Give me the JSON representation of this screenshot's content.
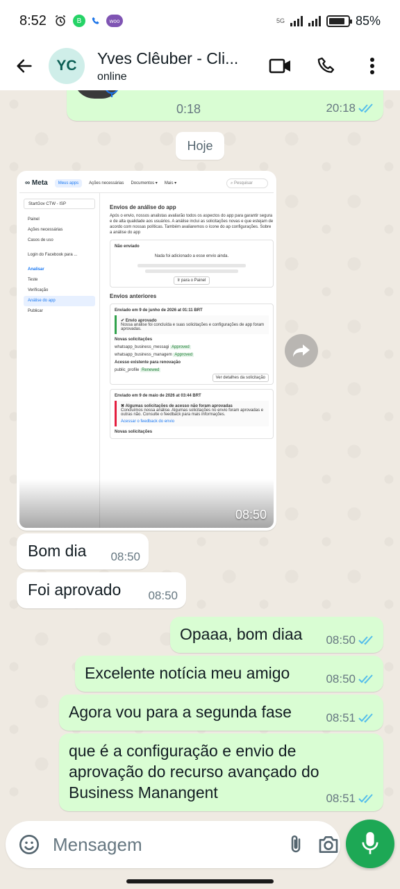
{
  "status_bar": {
    "time": "8:52",
    "network": "5G",
    "battery_pct": "85%",
    "battery_level": 0.85,
    "notification_badge": "woo"
  },
  "header": {
    "avatar_initials": "YC",
    "contact_name": "Yves Clêuber - Cli...",
    "status": "online"
  },
  "messages": {
    "audio": {
      "duration": "0:18",
      "time": "20:18"
    },
    "date_divider": "Hoje",
    "image": {
      "time": "08:50",
      "content": {
        "brand": "Meta",
        "nav": [
          "Meus apps",
          "Ações necessárias",
          "Documentos ▾",
          "Mais ▾"
        ],
        "search": "Pesquisar",
        "app_selector": "StartGov CTW - ISP",
        "sidebar": [
          "Painel",
          "Ações necessárias",
          "Casos de uso",
          "Login do Facebook para ...",
          "Analisar",
          "Teste",
          "Verificação",
          "Análise do app",
          "Publicar"
        ],
        "title": "Envios de análise do app",
        "intro": "Após o envio, nossos analistas avaliarão todos os aspectos do app para garantir segura e de alta qualidade aos usuários. A análise inclui as solicitações novas e que estejam de acordo com nossas políticas. Também avaliaremos o ícone do ap configurações. Sobre a análise do app",
        "not_sent": "Não enviado",
        "not_sent_text": "Nada foi adicionado a esse envio ainda.",
        "go_panel": "Ir para o Painel",
        "previous": "Envios anteriores",
        "sent1": "Enviado em 9 de junho de 2026 at 01:11 BRT",
        "approved": "Envio aprovado",
        "approved_text": "Nossa análise foi concluída e suas solicitações e configurações de app foram aprovadas.",
        "new_requests": "Novas solicitações",
        "req1": "whatsapp_business_messagi",
        "req2": "whatsapp_business_managem",
        "badge_approved": "Approved",
        "existing": "Acesso existente para renovação",
        "req3": "public_profile",
        "badge_renewed": "Renewed",
        "details_btn": "Ver detalhes da solicitação",
        "sent2": "Enviado em 9 de maio de 2026 at 03:44 BRT",
        "rejected": "Algumas solicitações de acesso não foram aprovadas",
        "rejected_text": "Concluímos nossa análise. Algumas solicitações no envio foram aprovadas e outras não. Consulte o feedback para mais informações.",
        "feedback_link": "Acessar o feedback do envio"
      }
    },
    "list": [
      {
        "text": "Bom dia",
        "time": "08:50"
      },
      {
        "text": "Foi aprovado",
        "time": "08:50"
      },
      {
        "text": "Opaaa, bom diaa",
        "time": "08:50"
      },
      {
        "text": "Excelente notícia meu amigo",
        "time": "08:50"
      },
      {
        "text": "Agora vou para a segunda fase",
        "time": "08:51"
      },
      {
        "text": "que é a configuração e envio de aprovação do recurso avançado do Business Manangent",
        "time": "08:51"
      }
    ]
  },
  "composer": {
    "placeholder": "Mensagem"
  },
  "colors": {
    "outgoing_bubble": "#d9fdd3",
    "incoming_bubble": "#ffffff",
    "read_ticks": "#53bdeb",
    "accent_green": "#1da855",
    "chat_bg": "#efeae2"
  }
}
